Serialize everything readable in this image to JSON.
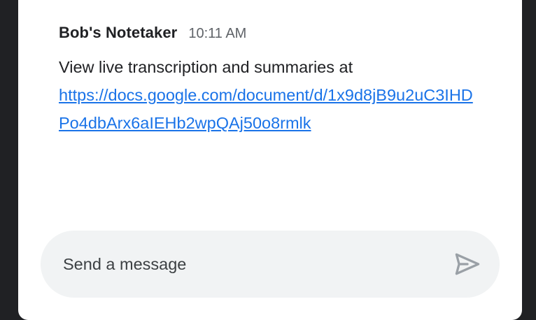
{
  "message": {
    "sender": "Bob's Notetaker",
    "time": "10:11 AM",
    "text": "View live transcription and summaries at",
    "link": "https://docs.google.com/document/d/1x9d8jB9u2uC3IHDPo4dbArx6aIEHb2wpQAj50o8rmlk"
  },
  "composer": {
    "placeholder": "Send a message",
    "send_icon": "send-icon"
  },
  "colors": {
    "background": "#202124",
    "panel": "#ffffff",
    "link": "#1a73e8",
    "composer_bg": "#f1f3f4",
    "send_icon": "#9aa0a6"
  }
}
